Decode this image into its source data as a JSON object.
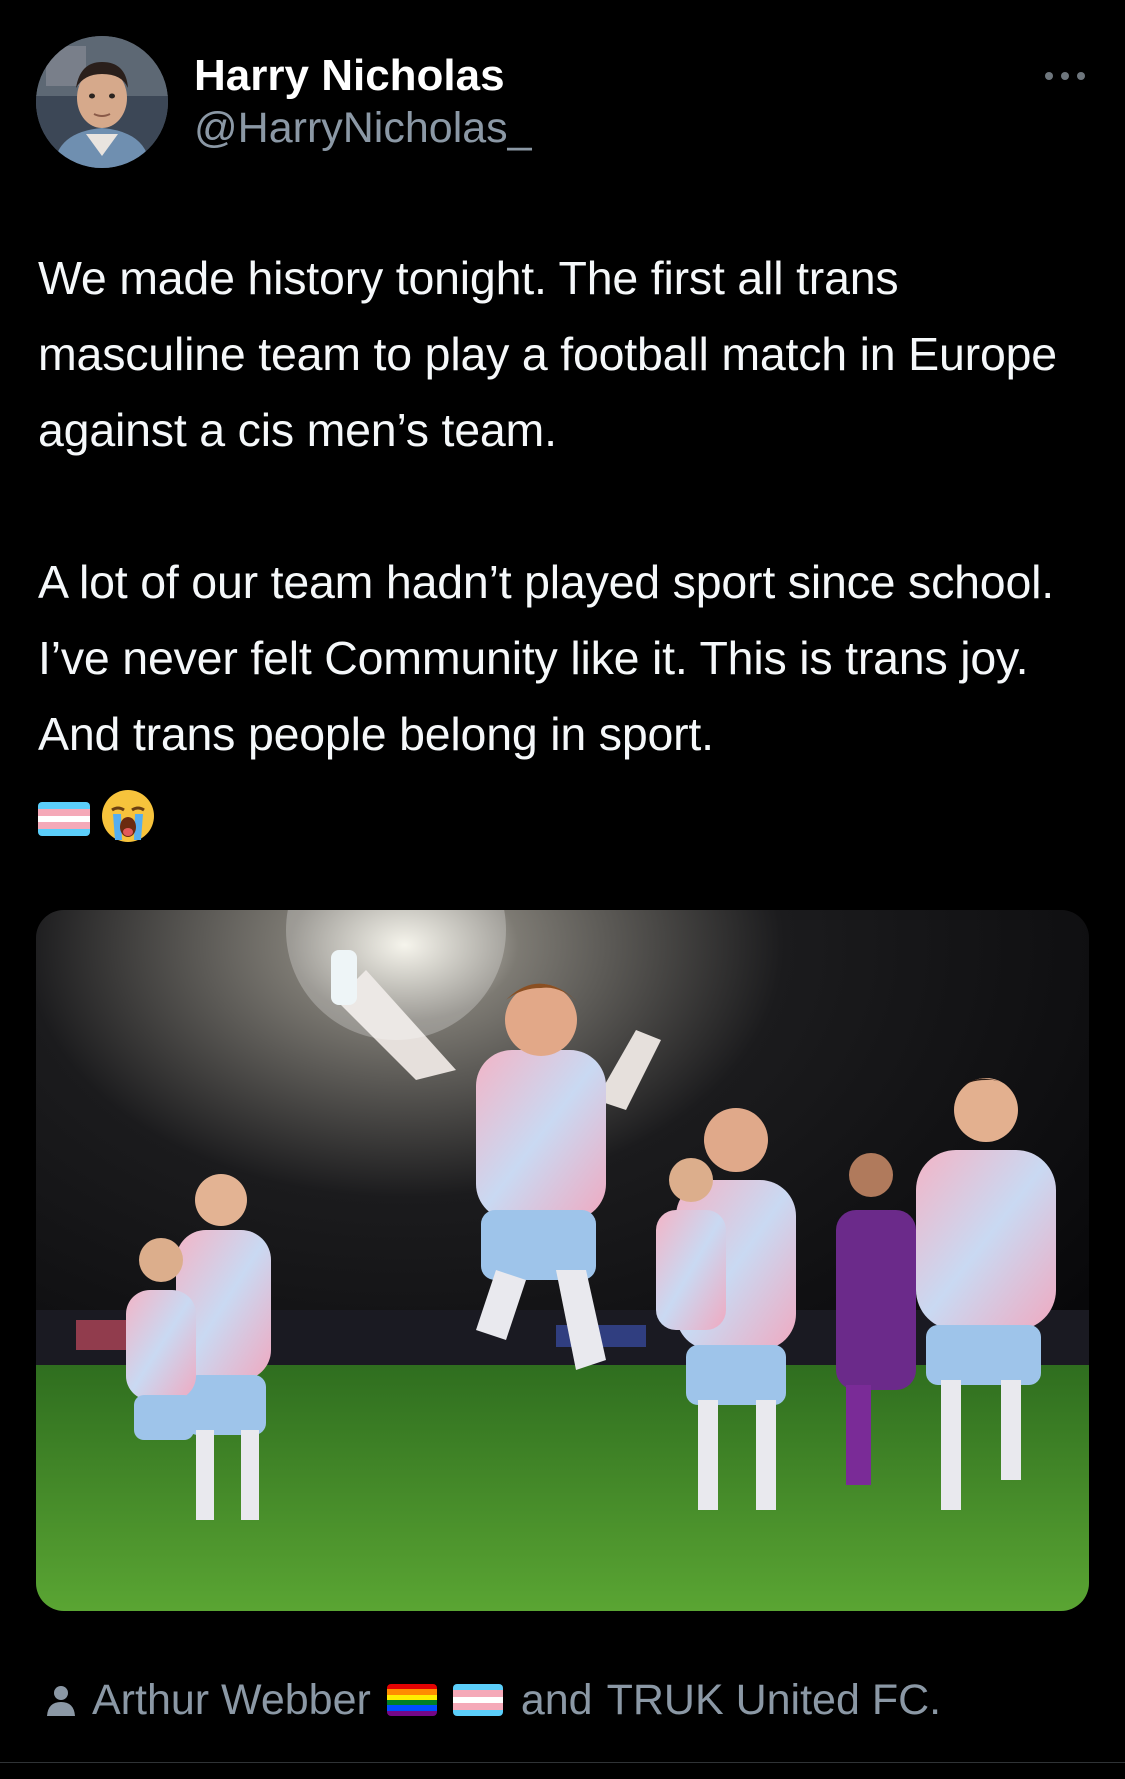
{
  "author": {
    "display_name": "Harry Nicholas",
    "handle": "@HarryNicholas_",
    "avatar_icon": "profile-photo"
  },
  "tweet": {
    "paragraph_1": "We made history tonight. The first all trans masculine team to play a football match in Europe against a cis men’s team.",
    "paragraph_2": "A lot of our team hadn’t played sport since school. I’ve never felt Community like it. This is trans joy. And trans people belong in sport.",
    "emojis": [
      "transgender-flag",
      "loudly-crying-face"
    ]
  },
  "media": {
    "description_icon": "football-team-celebration-photo"
  },
  "tagged": {
    "icon": "person-icon",
    "name_1": "Arthur Webber",
    "name_1_flags": [
      "rainbow-flag",
      "transgender-flag"
    ],
    "joiner": "and",
    "name_2": "TRUK United FC."
  },
  "colors": {
    "background": "#000000",
    "text": "#f5f8fa",
    "secondary_text": "#8b98a5",
    "trans_blue": "#5BCEFA",
    "trans_pink": "#F5A9B8",
    "trans_white": "#FFFFFF"
  }
}
